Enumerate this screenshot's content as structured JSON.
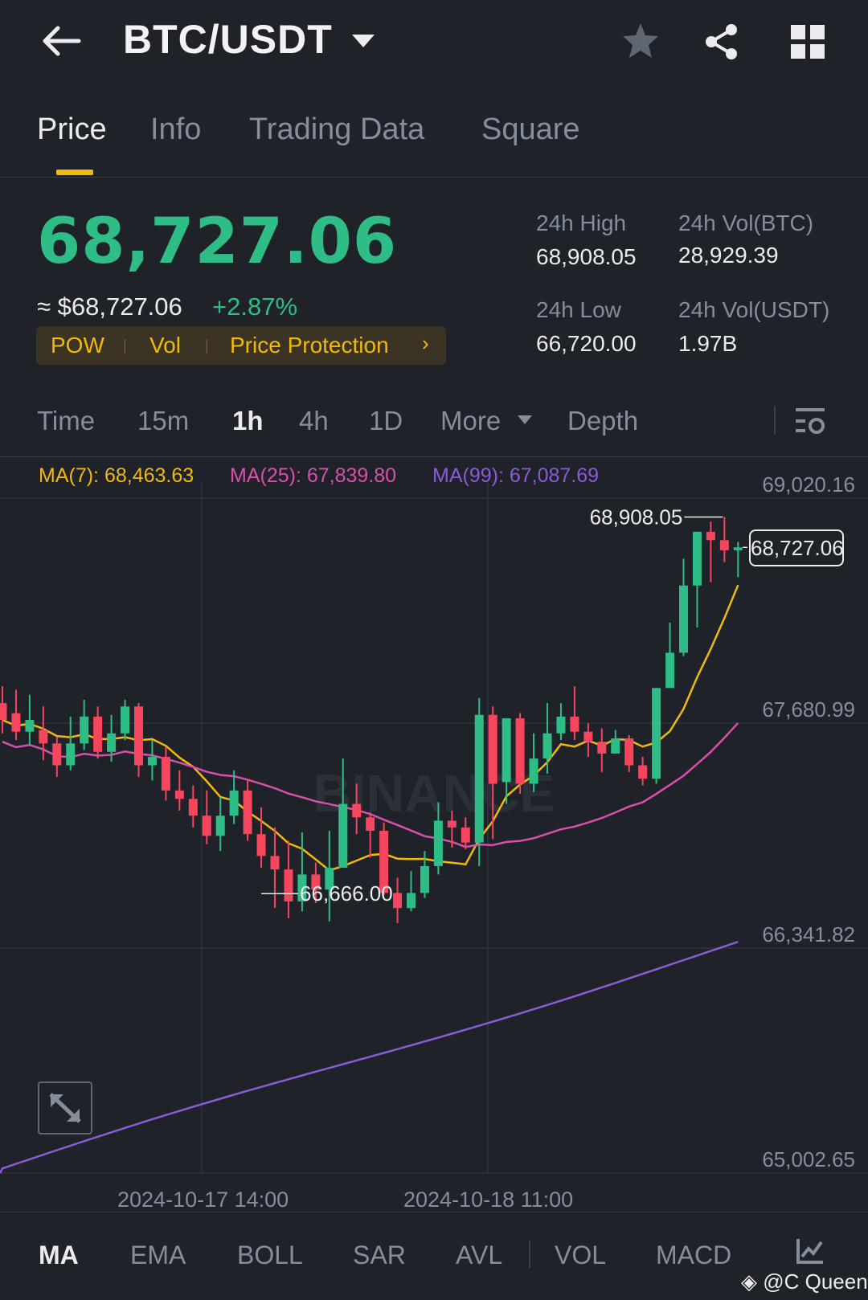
{
  "header": {
    "title": "BTC/USDT"
  },
  "tabs": [
    "Price",
    "Info",
    "Trading Data",
    "Square"
  ],
  "ticker": {
    "last_price": "68,727.06",
    "fiat_price": "≈ $68,727.06",
    "change_pct": "+2.87%",
    "tags": [
      "POW",
      "Vol",
      "Price Protection"
    ],
    "high_label": "24h High",
    "high_value": "68,908.05",
    "low_label": "24h Low",
    "low_value": "66,720.00",
    "vol_btc_label": "24h Vol(BTC)",
    "vol_btc_value": "28,929.39",
    "vol_usdt_label": "24h Vol(USDT)",
    "vol_usdt_value": "1.97B"
  },
  "timeframes": [
    "Time",
    "15m",
    "1h",
    "4h",
    "1D",
    "More",
    "Depth"
  ],
  "active_timeframe": "1h",
  "ma": {
    "ma7": "MA(7): 68,463.63",
    "ma25": "MA(25): 67,839.80",
    "ma99": "MA(99): 67,087.69"
  },
  "colors": {
    "up": "#2ebd85",
    "down": "#f6465d",
    "accent": "#f0b90b",
    "ma7": "#f0b90b",
    "ma25": "#d94fae",
    "ma99": "#8a5bd6"
  },
  "chart_data": {
    "type": "candlestick",
    "y_ticks": [
      "69,020.16",
      "67,680.99",
      "66,341.82",
      "65,002.65"
    ],
    "ylim": [
      65002.65,
      69020.16
    ],
    "x_ticks": [
      "2024-10-17 14:00",
      "2024-10-18 11:00"
    ],
    "high_marker": "68,908.05",
    "low_marker": "66,666.00",
    "last_price_tag": "68,727.06",
    "watermark": "BINANCE",
    "candles": [
      [
        67800,
        67700,
        67900,
        67620
      ],
      [
        67740,
        67630,
        67880,
        67580
      ],
      [
        67630,
        67700,
        67850,
        67550
      ],
      [
        67640,
        67560,
        67780,
        67460
      ],
      [
        67560,
        67430,
        67600,
        67360
      ],
      [
        67430,
        67560,
        67720,
        67400
      ],
      [
        67560,
        67720,
        67820,
        67520
      ],
      [
        67720,
        67510,
        67780,
        67470
      ],
      [
        67510,
        67620,
        67730,
        67450
      ],
      [
        67620,
        67780,
        67820,
        67580
      ],
      [
        67780,
        67430,
        67800,
        67360
      ],
      [
        67430,
        67480,
        67580,
        67340
      ],
      [
        67480,
        67280,
        67540,
        67220
      ],
      [
        67280,
        67230,
        67400,
        67160
      ],
      [
        67230,
        67130,
        67310,
        67060
      ],
      [
        67130,
        67010,
        67280,
        66960
      ],
      [
        67010,
        67130,
        67240,
        66920
      ],
      [
        67130,
        67280,
        67400,
        67080
      ],
      [
        67280,
        67020,
        67350,
        66980
      ],
      [
        67020,
        66890,
        67180,
        66820
      ],
      [
        66890,
        66810,
        67060,
        66580
      ],
      [
        66810,
        66620,
        66980,
        66520
      ],
      [
        66620,
        66780,
        67030,
        66560
      ],
      [
        66780,
        66690,
        66850,
        66610
      ],
      [
        66690,
        66820,
        67040,
        66500
      ],
      [
        66820,
        67200,
        67470,
        66840
      ],
      [
        67200,
        67120,
        67320,
        67020
      ],
      [
        67120,
        67040,
        67150,
        66880
      ],
      [
        67040,
        66670,
        67090,
        66660
      ],
      [
        66670,
        66580,
        66760,
        66490
      ],
      [
        66580,
        66670,
        66800,
        66560
      ],
      [
        66670,
        66830,
        66920,
        66640
      ],
      [
        66830,
        67100,
        67210,
        66780
      ],
      [
        67100,
        67060,
        67160,
        66940
      ],
      [
        67060,
        66970,
        67120,
        66930
      ],
      [
        66970,
        67730,
        67830,
        66830
      ],
      [
        67730,
        67320,
        67780,
        66990
      ],
      [
        67330,
        67710,
        67680,
        67200
      ],
      [
        67710,
        67320,
        67740,
        67260
      ],
      [
        67320,
        67470,
        67620,
        67270
      ],
      [
        67470,
        67620,
        67800,
        67380
      ],
      [
        67620,
        67720,
        67800,
        67580
      ],
      [
        67720,
        67630,
        67900,
        67580
      ],
      [
        67630,
        67570,
        67680,
        67480
      ],
      [
        67570,
        67500,
        67650,
        67390
      ],
      [
        67500,
        67590,
        67640,
        67500
      ],
      [
        67590,
        67430,
        67610,
        67390
      ],
      [
        67430,
        67350,
        67480,
        67310
      ],
      [
        67350,
        67890,
        67890,
        67320
      ],
      [
        67890,
        68100,
        68280,
        67980
      ],
      [
        68100,
        68500,
        68660,
        68080
      ],
      [
        68500,
        68820,
        68820,
        68250
      ],
      [
        68820,
        68770,
        68880,
        68520
      ],
      [
        68770,
        68710,
        68908,
        68640
      ],
      [
        68710,
        68727,
        68760,
        68550
      ]
    ]
  }
}
